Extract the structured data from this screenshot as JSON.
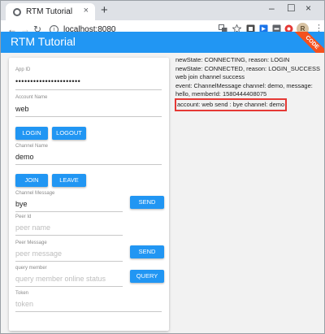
{
  "browser": {
    "tab_title": "RTM Tutorial",
    "tab_close": "×",
    "new_tab": "+",
    "win_min": "–",
    "win_max": "☐",
    "win_close": "×",
    "back": "←",
    "forward": "→",
    "reload": "↻",
    "url": "localhost:8080",
    "avatar_letter": "R",
    "menu": "⋮"
  },
  "app": {
    "title": "RTM Tutorial",
    "ribbon": "CODE"
  },
  "form": {
    "app_id": {
      "label": "App ID",
      "value": "••••••••••••••••••••••"
    },
    "account_name": {
      "label": "Account Name",
      "value": "web"
    },
    "login_label": "LOGIN",
    "logout_label": "LOGOUT",
    "channel_name": {
      "label": "Channel Name",
      "value": "demo"
    },
    "join_label": "JOIN",
    "leave_label": "LEAVE",
    "channel_message": {
      "label": "Channel Message",
      "value": "bye"
    },
    "send_channel_label": "SEND",
    "peer_id": {
      "label": "Peer Id",
      "placeholder": "peer name"
    },
    "peer_message": {
      "label": "Peer Message",
      "placeholder": "peer message"
    },
    "send_peer_label": "SEND",
    "query_member": {
      "label": "query member",
      "placeholder": "query member online status"
    },
    "query_label": "QUERY",
    "token": {
      "label": "Token",
      "placeholder": "token"
    }
  },
  "log": {
    "lines": [
      "newState: CONNECTING, reason: LOGIN",
      "newState: CONNECTED, reason: LOGIN_SUCCESS",
      "web join channel success",
      "event: ChannelMessage channel: demo, message: hello, memberId: 1580444408075"
    ],
    "highlighted": "account: web send : bye channel: demo"
  },
  "colors": {
    "accent": "#2196f3",
    "ribbon": "#f4511e",
    "highlight_border": "#e53935"
  }
}
